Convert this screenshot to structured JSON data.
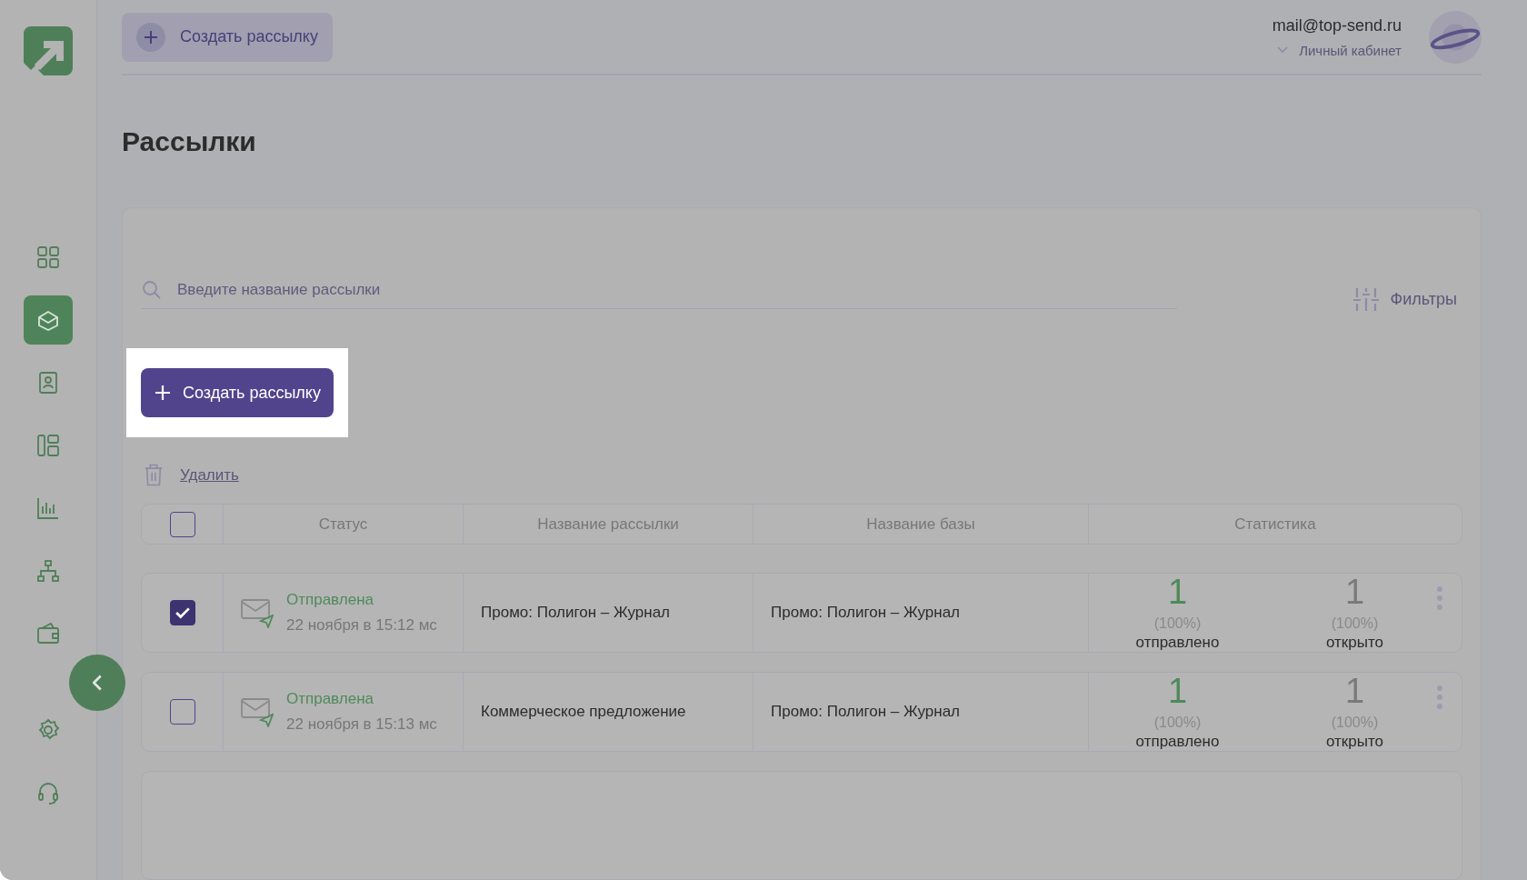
{
  "sidebar": {
    "items": [
      {
        "selected": false
      },
      {
        "selected": true
      },
      {
        "selected": false
      },
      {
        "selected": false
      },
      {
        "selected": false
      },
      {
        "selected": false
      },
      {
        "selected": false
      }
    ],
    "bottom_items": [
      {
        "selected": false
      },
      {
        "selected": false
      }
    ]
  },
  "top_bar": {
    "create_button": "Создать рассылку",
    "email": "mail@top-send.ru",
    "account_link": "Личный кабинет"
  },
  "page_title": "Рассылки",
  "search": {
    "placeholder": "Введите название рассылки"
  },
  "filters": "Фильтры",
  "create_button": "Создать рассылку",
  "delete_link": "Удалить",
  "table": {
    "select_all_checked": false,
    "columns": [
      "Статус",
      "Название рассылки",
      "Название базы",
      "Статистика"
    ],
    "rows": [
      {
        "checked": true,
        "status": "Отправлена",
        "date": "22 ноября в 15:12 мс",
        "name": "Промо: Полигон – Журнал",
        "base": "Промо: Полигон – Журнал",
        "sent": {
          "value": "1",
          "percent": "(100%)",
          "label": "отправлено"
        },
        "opened": {
          "value": "1",
          "percent": "(100%)",
          "label": "открыто"
        }
      },
      {
        "checked": false,
        "status": "Отправлена",
        "date": "22 ноября в 15:13 мс",
        "name": "Коммерческое предложение",
        "base": "Промо: Полигон – Журнал",
        "sent": {
          "value": "1",
          "percent": "(100%)",
          "label": "отправлено"
        },
        "opened": {
          "value": "1",
          "percent": "(100%)",
          "label": "открыто"
        }
      }
    ]
  }
}
